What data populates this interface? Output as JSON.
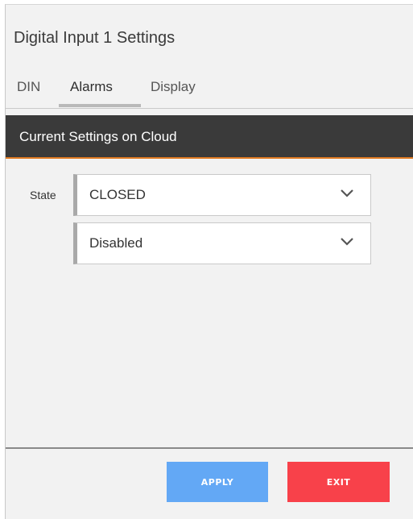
{
  "dialog": {
    "title": "Digital Input 1 Settings",
    "tabs": [
      {
        "label": "DIN",
        "active": false
      },
      {
        "label": "Alarms",
        "active": true
      },
      {
        "label": "Display",
        "active": false
      }
    ]
  },
  "section": {
    "header": "Current Settings on Cloud"
  },
  "form": {
    "state_label": "State",
    "state_select": {
      "value": "CLOSED",
      "icon": "chevron-down-icon"
    },
    "mode_select": {
      "value": "Disabled",
      "icon": "chevron-down-icon"
    }
  },
  "footer": {
    "apply_label": "APPLY",
    "exit_label": "EXIT"
  },
  "colors": {
    "header_bg": "#3a3a3a",
    "accent": "#e07b22",
    "apply": "#63a8f5",
    "exit": "#f8414a"
  }
}
